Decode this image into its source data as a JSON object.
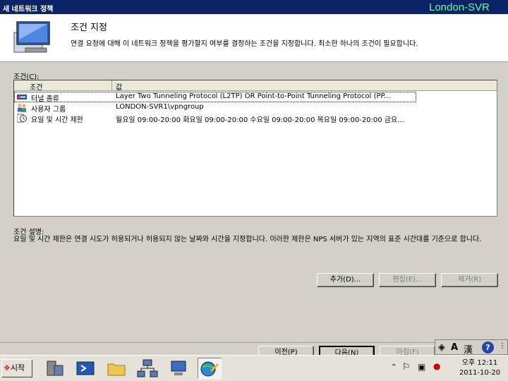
{
  "window": {
    "title": "새 네트워크 정책",
    "server": "London-SVR"
  },
  "header": {
    "heading": "조건 지정",
    "description": "연결 요청에 대해 이 네트워크 정책을 평가할지 여부를 결정하는 조건을 지정합니다. 최소한 하나의 조건이 필요합니다."
  },
  "conditions": {
    "label": "조건(C):",
    "columns": [
      "조건",
      "값"
    ],
    "rows": [
      {
        "name": "터널 종류",
        "value": "Layer Two Tunneling Protocol (L2TP) OR Point-to-Point Tunneling Protocol (PP...",
        "icon": "tunnel-icon"
      },
      {
        "name": "사용자 그룹",
        "value": "LONDON-SVR1\\vpngroup",
        "icon": "user-group-icon"
      },
      {
        "name": "요일 및 시간 제한",
        "value": "월요일 09:00-20:00 화요일 09:00-20:00 수요일 09:00-20:00 목요일 09:00-20:00 금요...",
        "icon": "clock-icon"
      }
    ]
  },
  "description": {
    "label": "조건 설명:",
    "text": "요일 및 시간 제한은 연결 시도가 허용되거나 허용되지 않는 날짜와 시간을 지정합니다. 이러한 제한은 NPS 서버가 있는 지역의 표준 시간대를 기준으로 합니다."
  },
  "buttons": {
    "add": "추가(D)...",
    "edit": "편집(E)...",
    "remove": "제거(R)"
  },
  "nav": {
    "prev": "이전(P)",
    "next": "다음(N)",
    "finish": "마침(F)"
  },
  "ime": {
    "lang": "A",
    "hanja": "漢"
  },
  "taskbar": {
    "start": "시작",
    "clock_ampm": "오후 12:11",
    "date": "2011-10-20"
  }
}
